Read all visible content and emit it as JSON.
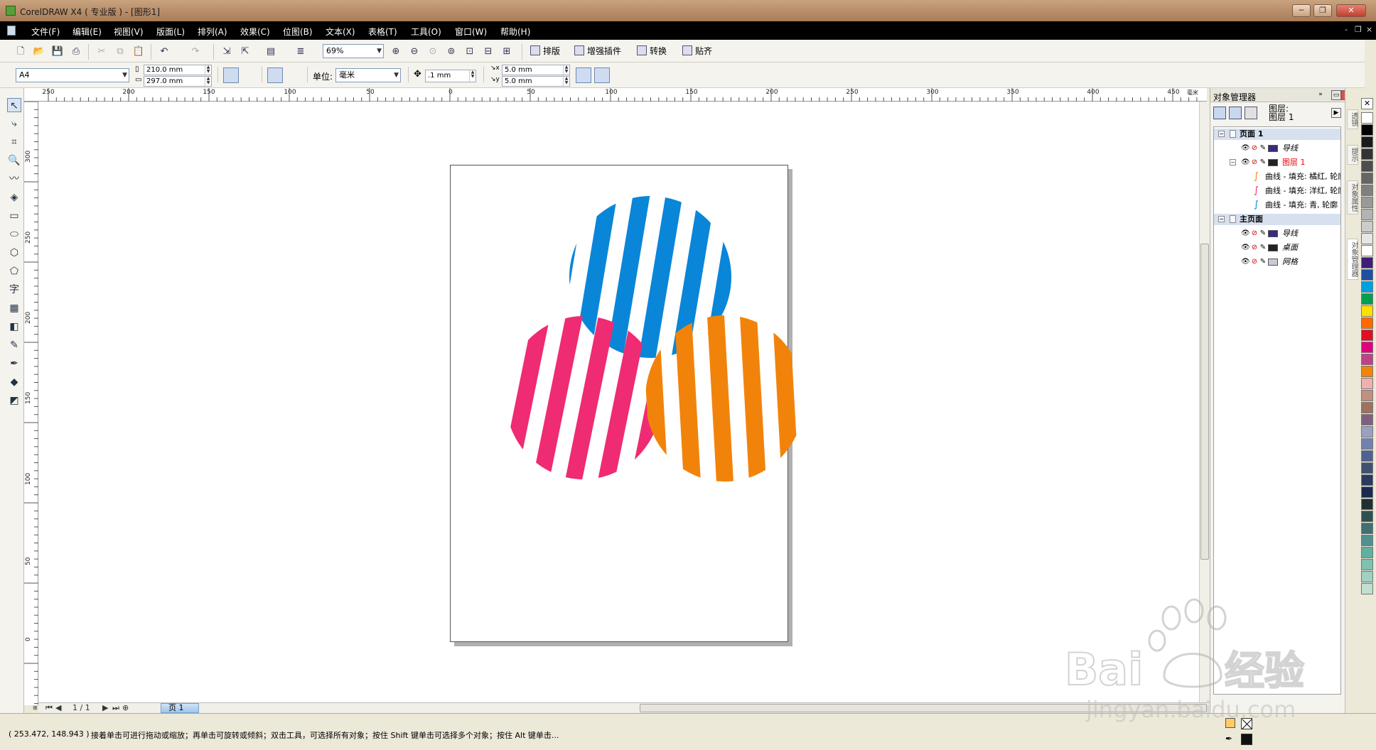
{
  "window": {
    "title": "CorelDRAW X4 ( 专业版 ) - [图形1]",
    "buttons": {
      "minimize": "─",
      "restore": "❐",
      "close": "✕"
    }
  },
  "menu": {
    "items": [
      "文件(F)",
      "编辑(E)",
      "视图(V)",
      "版面(L)",
      "排列(A)",
      "效果(C)",
      "位图(B)",
      "文本(X)",
      "表格(T)",
      "工具(O)",
      "窗口(W)",
      "帮助(H)"
    ],
    "mdi_buttons": {
      "minimize": "-",
      "restore": "❐",
      "close": "×"
    }
  },
  "toolbar": {
    "zoom_value": "69%",
    "text_buttons": [
      "排版",
      "增强插件",
      "转换",
      "贴齐"
    ]
  },
  "property_bar": {
    "paper_size": "A4",
    "width": "210.0 mm",
    "height": "297.0 mm",
    "unit_label": "单位:",
    "unit_value": "毫米",
    "nudge": ".1 mm",
    "dup_x": "5.0 mm",
    "dup_y": "5.0 mm"
  },
  "rulers": {
    "horizontal": [
      "250",
      "200",
      "150",
      "100",
      "50",
      "0",
      "50",
      "100",
      "150",
      "200",
      "250",
      "300",
      "350",
      "400",
      "450"
    ],
    "h_unit": "毫米",
    "vertical": [
      "300",
      "250",
      "200",
      "150",
      "100",
      "50",
      "0"
    ]
  },
  "artwork": {
    "circles": [
      {
        "name": "blue-circle",
        "color": "#0a86d8"
      },
      {
        "name": "pink-circle",
        "color": "#ee2b73"
      },
      {
        "name": "orange-circle",
        "color": "#f2830a"
      }
    ]
  },
  "page_nav": {
    "count": "1 / 1",
    "tab": "页 1"
  },
  "docker": {
    "title": "对象管理器",
    "layer_label_1": "图层:",
    "layer_label_2": "图层 1",
    "tree": [
      {
        "type": "header",
        "label": "页面 1"
      },
      {
        "type": "layer",
        "label": "导线",
        "swatch": "#3a2a80"
      },
      {
        "type": "layer",
        "label": "图层 1",
        "swatch": "#222222",
        "active": true
      },
      {
        "type": "curve",
        "label": "曲线 - 填充: 橘红, 轮廓",
        "color": "#f2830a"
      },
      {
        "type": "curve",
        "label": "曲线 - 填充: 洋红, 轮廓",
        "color": "#ee2b73"
      },
      {
        "type": "curve",
        "label": "曲线 - 填充: 青, 轮廓",
        "color": "#0a86d8"
      },
      {
        "type": "header",
        "label": "主页面"
      },
      {
        "type": "layer",
        "label": "导线",
        "swatch": "#3a2a80"
      },
      {
        "type": "layer",
        "label": "桌面",
        "swatch": "#222222"
      },
      {
        "type": "layer",
        "label": "网格",
        "swatch": "#c8c8d8"
      }
    ]
  },
  "docker_tabs": [
    "透镜",
    "提示",
    "对象属性",
    "对象管理器"
  ],
  "palette": [
    "#ffffff",
    "#000000",
    "#1a1a1a",
    "#333333",
    "#4d4d4d",
    "#666666",
    "#808080",
    "#999999",
    "#b3b3b3",
    "#cccccc",
    "#e6e6e6",
    "#ffffff",
    "#3c1e7a",
    "#1e4fa0",
    "#00a0e0",
    "#00a050",
    "#ffe000",
    "#ff6a00",
    "#e01020",
    "#e0007a",
    "#c0408a",
    "#f2830a",
    "#f0b0b0",
    "#c09080",
    "#a07060",
    "#806080",
    "#9aa0c0",
    "#7080b0",
    "#506090",
    "#405070",
    "#2a3a60",
    "#1a2a50",
    "#203030",
    "#305050",
    "#407070",
    "#509090",
    "#60b0a0",
    "#80c0b0",
    "#a0d0c0",
    "#c0e0d0"
  ],
  "status": {
    "coords": "( 253.472, 148.943 )",
    "hint": "接着单击可进行拖动或缩放；再单击可旋转或倾斜；双击工具，可选择所有对象；按住 Shift 键单击可选择多个对象；按住 Alt 键单击..."
  },
  "watermark": {
    "brand": "Baidu经验",
    "url": "jingyan.baidu.com"
  }
}
